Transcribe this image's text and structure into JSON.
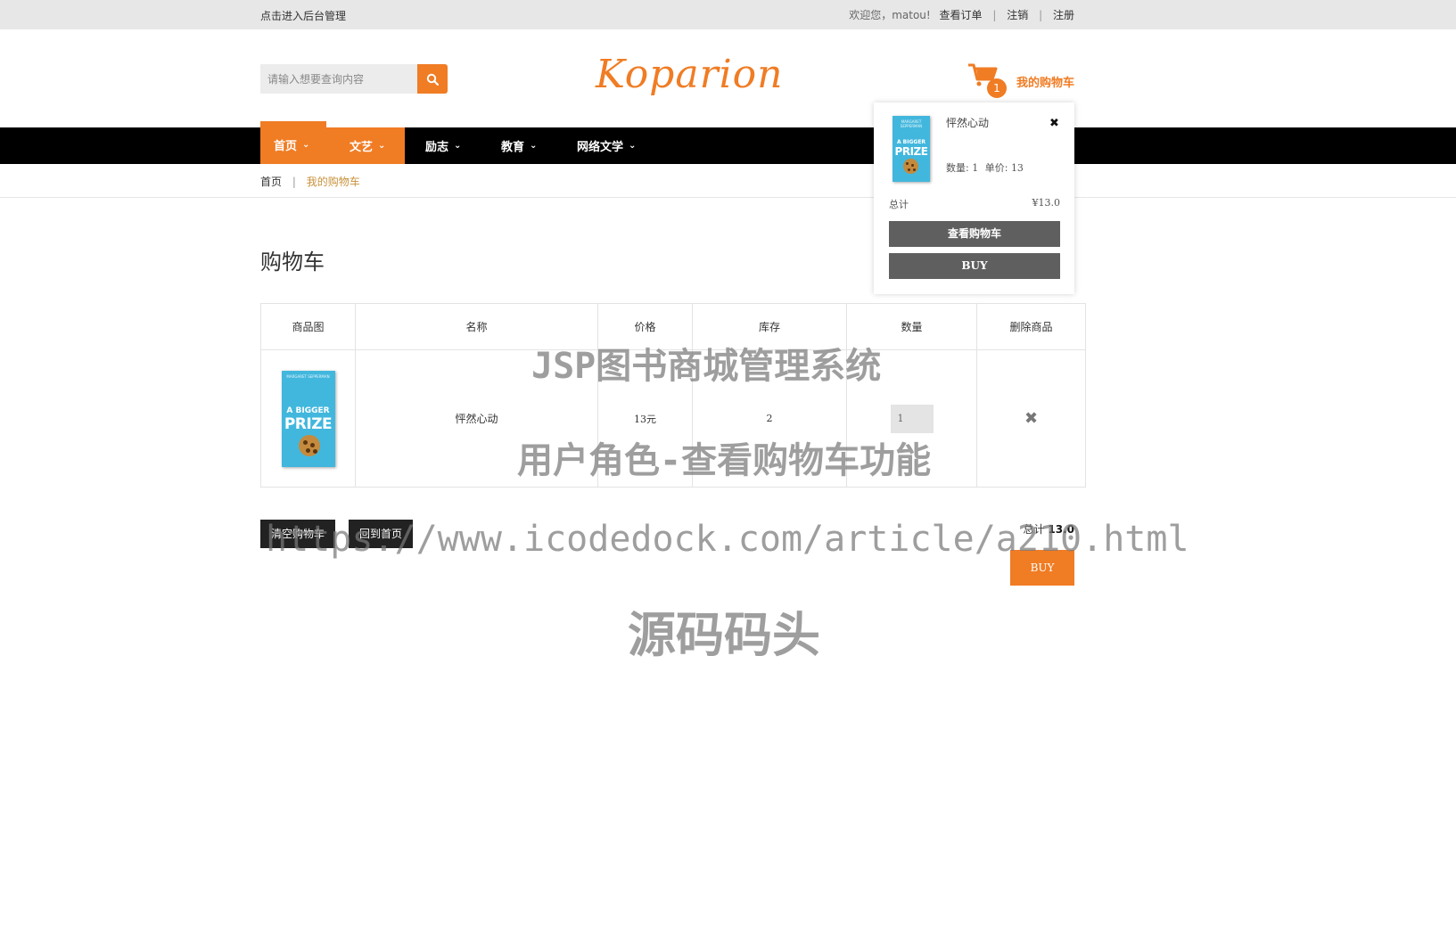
{
  "topbar": {
    "admin_link": "点击进入后台管理",
    "welcome": "欢迎您，matou!",
    "orders_link": "查看订单",
    "logout_link": "注销",
    "register_link": "注册",
    "separator": "|"
  },
  "header": {
    "search_placeholder": "请输入想要查询内容",
    "logo_text": "Koparion",
    "cart_count": "1",
    "cart_label": "我的购物车"
  },
  "nav": {
    "items": [
      {
        "label": "首页",
        "active": true
      },
      {
        "label": "文艺"
      },
      {
        "label": "励志"
      },
      {
        "label": "教育"
      },
      {
        "label": "网络文学"
      }
    ],
    "chevron": "⌄"
  },
  "breadcrumb": {
    "home": "首页",
    "separator": "|",
    "current": "我的购物车"
  },
  "page": {
    "title": "购物车"
  },
  "table": {
    "headers": [
      "商品图",
      "名称",
      "价格",
      "库存",
      "数量",
      "删除商品"
    ],
    "rows": [
      {
        "name": "怦然心动",
        "price": "13元",
        "stock": "2",
        "qty": "1",
        "delete": "✖"
      }
    ]
  },
  "book_cover": {
    "author": "MARGARET SEPPERMAN",
    "line1": "A BIGGER",
    "line2": "PRIZE"
  },
  "actions": {
    "clear_cart": "清空购物车",
    "back_home": "回到首页",
    "total_label": "总计",
    "total_value": "13.0",
    "buy": "BUY"
  },
  "mini_cart": {
    "item_name": "怦然心动",
    "close": "✖",
    "qty_label": "数量:",
    "qty_value": "1",
    "unit_label": "单价:",
    "unit_value": "13",
    "total_label": "总计",
    "total_value": "¥13.0",
    "view_cart": "查看购物车",
    "buy": "BUY"
  },
  "watermarks": {
    "line1": "JSP图书商城管理系统",
    "line2": "用户角色-查看购物车功能",
    "line3": "https://www.icodedock.com/article/a210.html",
    "line4": "源码码头"
  },
  "colors": {
    "accent": "#f07c24",
    "nav_bg": "#000000",
    "topbar_bg": "#e7e7e7",
    "book_blue": "#42b7dd"
  }
}
